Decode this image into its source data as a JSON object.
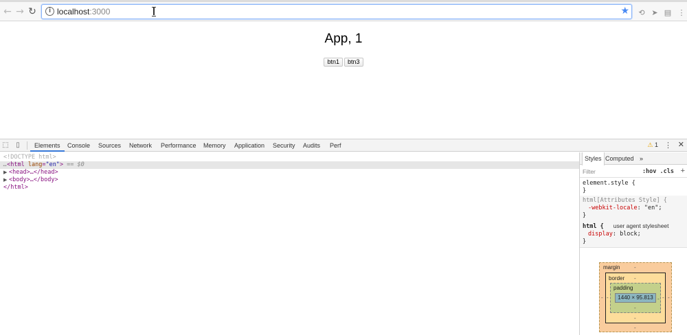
{
  "browser": {
    "url_host": "localhost",
    "url_port": ":3000",
    "icons": {
      "back": "arrow-left-icon",
      "forward": "arrow-right-icon",
      "reload": "reload-icon",
      "bookmark": "star-icon"
    }
  },
  "page": {
    "title": "App, 1",
    "buttons": [
      "btn1",
      "btn3"
    ]
  },
  "devtools": {
    "tabs": [
      "Elements",
      "Console",
      "Sources",
      "Network",
      "Performance",
      "Memory",
      "Application",
      "Security",
      "Audits",
      "Perf"
    ],
    "active_tab": "Elements",
    "warning_count": "1",
    "dom": {
      "doctype": "<!DOCTYPE html>",
      "html_open": "<html",
      "lang_attr": "lang",
      "lang_val": "\"en\"",
      "html_close_bracket": ">",
      "selected_marker": " == $0",
      "head": "<head>…</head>",
      "body": "<body>…</body>",
      "html_end": "</html>"
    },
    "styles": {
      "tabs": [
        "Styles",
        "Computed"
      ],
      "more": "»",
      "filter_placeholder": "Filter",
      "filter_opts": ":hov  .cls",
      "add": "+",
      "rules": [
        {
          "selector": "element.style {",
          "close": "}"
        },
        {
          "selector": "html[Attributes Style] {",
          "prop": "-webkit-locale",
          "value": " \"en\";",
          "close": "}"
        },
        {
          "selector": "html {",
          "source": "user agent stylesheet",
          "prop": "display",
          "value": " block;",
          "close": "}"
        }
      ]
    },
    "box_model": {
      "margin_label": "margin",
      "border_label": "border",
      "padding_label": "padding",
      "content_size": "1440 × 95.813",
      "dash": "-"
    }
  }
}
